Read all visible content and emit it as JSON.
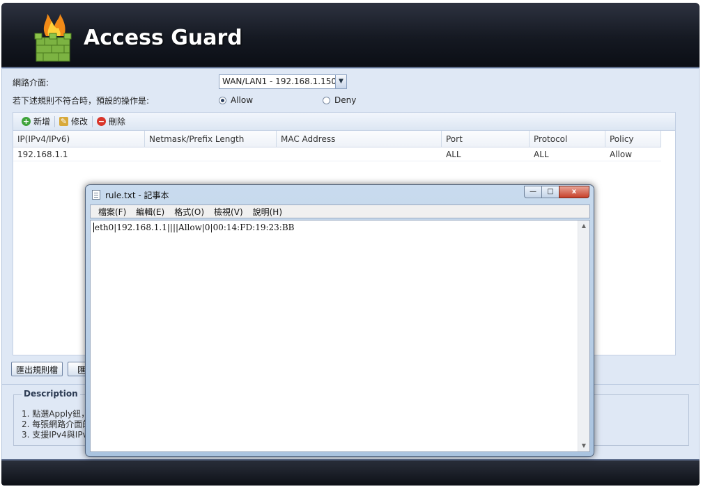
{
  "header": {
    "title": "Access Guard",
    "logo_icon": "firewall-flame-icon"
  },
  "form": {
    "interface_label": "網路介面:",
    "interface_value": "WAN/LAN1 - 192.168.1.150",
    "default_action_label": "若下述規則不符合時，預設的操作是:",
    "default_action_options": [
      {
        "label": "Allow",
        "checked": true
      },
      {
        "label": "Deny",
        "checked": false
      }
    ]
  },
  "toolbar": {
    "add_label": "新增",
    "edit_label": "修改",
    "delete_label": "刪除"
  },
  "grid": {
    "columns": [
      "IP(IPv4/IPv6)",
      "Netmask/Prefix Length",
      "MAC Address",
      "Port",
      "Protocol",
      "Policy"
    ],
    "rows": [
      {
        "ip": "192.168.1.1",
        "netmask": "",
        "mac": "",
        "port": "ALL",
        "protocol": "ALL",
        "policy": "Allow"
      }
    ]
  },
  "buttons": {
    "export_label": "匯出規則檔",
    "import_label": "匯"
  },
  "description": {
    "legend": "Description",
    "lines": [
      "1. 點選Apply鈕，",
      "2. 每張網路介面的",
      "3. 支援IPv4與IPv"
    ]
  },
  "notepad": {
    "title": "rule.txt - 記事本",
    "menus": [
      "檔案(F)",
      "編輯(E)",
      "格式(O)",
      "檢視(V)",
      "說明(H)"
    ],
    "content": "eth0|192.168.1.1||||Allow|0|00:14:FD:19:23:BB",
    "controls": {
      "minimize": "—",
      "maximize": "□",
      "close": "x"
    }
  }
}
